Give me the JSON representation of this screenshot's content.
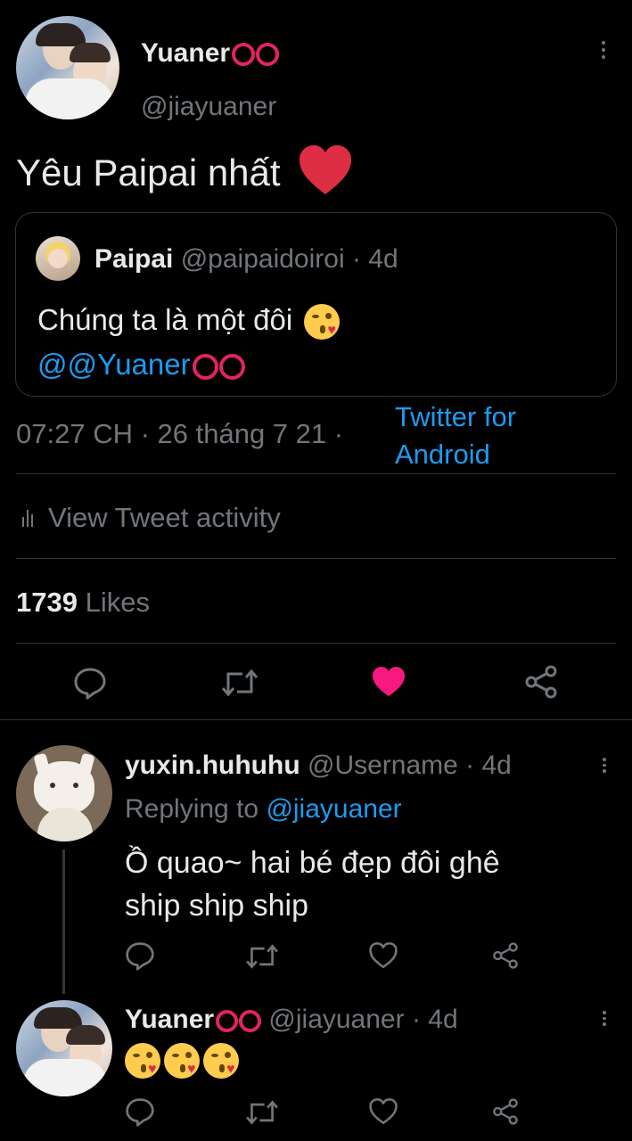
{
  "main_tweet": {
    "author_name": "Yuaner",
    "author_handle": "@jiayuaner",
    "text": "Yêu Paipai nhất",
    "quote": {
      "author_name": "Paipai",
      "author_handle": "@paipaidoiroi",
      "separator": "·",
      "age": "4d",
      "text": "Chúng ta là một đôi",
      "mention": "@@Yuaner"
    },
    "time": "07:27 CH · 26 tháng 7 21 ·",
    "source_line1": "Twitter for",
    "source_line2": "Android",
    "activity_label": "View Tweet activity",
    "likes_count": "1739",
    "likes_label": "Likes",
    "liked": true
  },
  "replies": [
    {
      "author_name": "yuxin.huhuhu",
      "author_handle": "@Username",
      "age": "· 4d",
      "replying_prefix": "Replying to",
      "replying_handle": "@jiayuaner",
      "text_line1": "Ồ quao~ hai bé đẹp đôi ghê",
      "text_line2": "ship ship ship"
    },
    {
      "author_name": "Yuaner",
      "author_handle": "@jiayuaner",
      "age": "· 4d"
    }
  ],
  "colors": {
    "background": "#000000",
    "accent_blue": "#1d9bf0",
    "like_red": "#f91880",
    "ring_red": "#e0245e"
  },
  "icons": [
    "more-icon",
    "heart-emoji",
    "kiss-emoji",
    "reply-icon",
    "retweet-icon",
    "like-icon",
    "share-icon",
    "activity-icon"
  ]
}
